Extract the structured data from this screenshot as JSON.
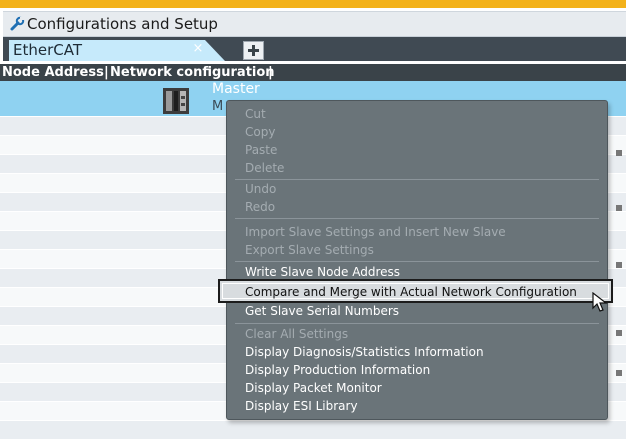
{
  "window": {
    "title": "Configurations and Setup",
    "title_icon": "wrench-icon",
    "accent_color": "#f3b21b"
  },
  "tabs": [
    {
      "label": "EtherCAT",
      "close_glyph": "×",
      "active": true
    }
  ],
  "new_tab_icon": "plus-icon",
  "table_header": {
    "col1": "Node Address",
    "sep1": "|",
    "col2": "Network configuration",
    "sep2": "|"
  },
  "master_row": {
    "label": "Master",
    "sub_label": "M",
    "icon": "device-icon",
    "selected_color": "#8fd2f1"
  },
  "context_menu": {
    "items": [
      {
        "label": "Cut",
        "enabled": false
      },
      {
        "label": "Copy",
        "enabled": false
      },
      {
        "label": "Paste",
        "enabled": false
      },
      {
        "label": "Delete",
        "enabled": false
      },
      {
        "label": "Undo",
        "enabled": false
      },
      {
        "label": "Redo",
        "enabled": false
      },
      {
        "label": "Import Slave Settings and Insert New Slave",
        "enabled": false
      },
      {
        "label": "Export Slave Settings",
        "enabled": false
      },
      {
        "label": "Write Slave Node Address",
        "enabled": true
      },
      {
        "label": "Compare and Merge with Actual Network Configuration",
        "enabled": true,
        "highlighted": true
      },
      {
        "label": "Get Slave Serial Numbers",
        "enabled": true
      },
      {
        "label": "Clear All Settings",
        "enabled": false
      },
      {
        "label": "Display Diagnosis/Statistics Information",
        "enabled": true
      },
      {
        "label": "Display Production Information",
        "enabled": true
      },
      {
        "label": "Display Packet Monitor",
        "enabled": true
      },
      {
        "label": "Display ESI Library",
        "enabled": true
      }
    ]
  }
}
